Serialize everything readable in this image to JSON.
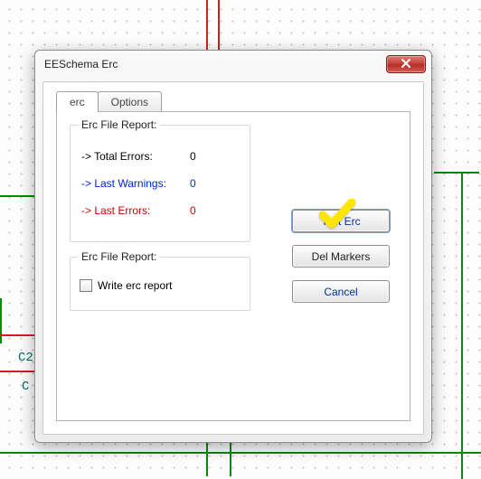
{
  "window": {
    "title": "EESchema Erc"
  },
  "tabs": {
    "erc": "erc",
    "options": "Options"
  },
  "group1": {
    "legend": "Erc File Report:",
    "total_label": "-> Total Errors:",
    "total_value": "0",
    "warn_label": "-> Last Warnings:",
    "warn_value": "0",
    "err_label": "-> Last Errors:",
    "err_value": "0"
  },
  "group2": {
    "legend": "Erc File Report:",
    "write_label": "Write erc report"
  },
  "buttons": {
    "test": "Test Erc",
    "del": "Del Markers",
    "cancel": "Cancel"
  },
  "bg_labels": {
    "c2": "C2",
    "c": "C"
  }
}
